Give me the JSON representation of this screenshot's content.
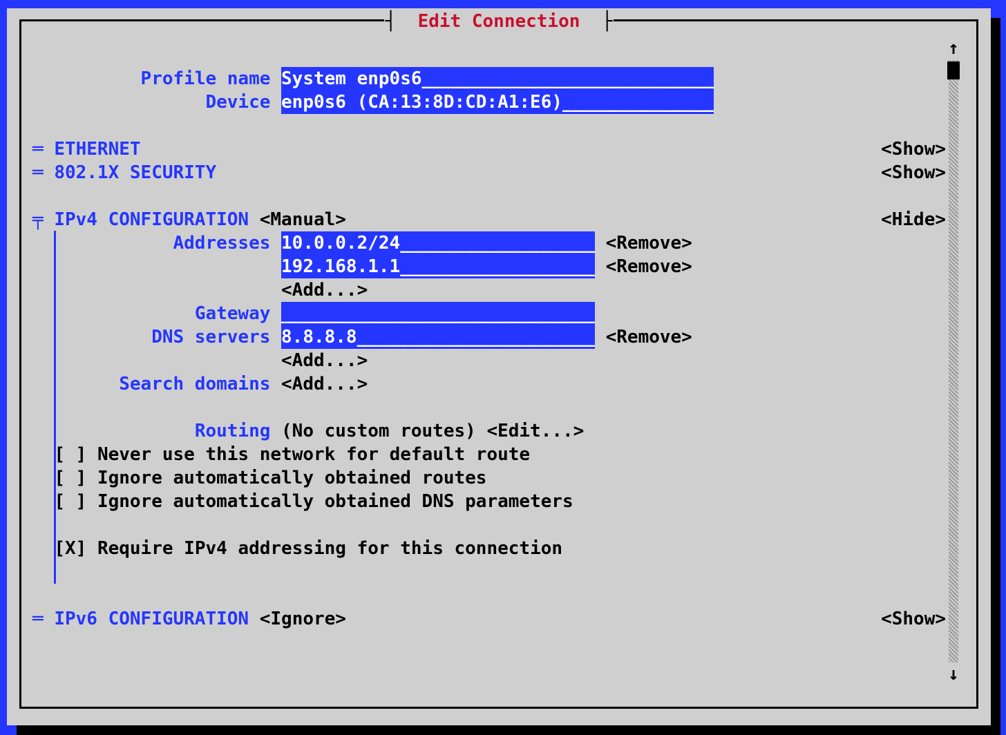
{
  "window": {
    "title": "Edit Connection"
  },
  "fields": {
    "profile_name_label": "Profile name",
    "profile_name_value": "System enp0s6",
    "device_label": "Device",
    "device_value": "enp0s6 (CA:13:8D:CD:A1:E6)"
  },
  "sections": {
    "ethernet": {
      "label": "ETHERNET",
      "toggle": "<Show>"
    },
    "dot1x": {
      "label": "802.1X SECURITY",
      "toggle": "<Show>"
    },
    "ipv4": {
      "label": "IPv4 CONFIGURATION",
      "mode": "<Manual>",
      "toggle": "<Hide>",
      "addresses_label": "Addresses",
      "addresses": [
        "10.0.0.2/24",
        "192.168.1.1"
      ],
      "gateway_label": "Gateway",
      "gateway_value": "",
      "dns_label": "DNS servers",
      "dns": [
        "8.8.8.8"
      ],
      "search_label": "Search domains",
      "routing_label": "Routing",
      "routing_text": "(No custom routes)",
      "routing_edit": "<Edit...>",
      "add_label": "<Add...>",
      "remove_label": "<Remove>",
      "opt_never_default": {
        "checked": false,
        "label": "Never use this network for default route"
      },
      "opt_ignore_routes": {
        "checked": false,
        "label": "Ignore automatically obtained routes"
      },
      "opt_ignore_dns": {
        "checked": false,
        "label": "Ignore automatically obtained DNS parameters"
      },
      "opt_require_ipv4": {
        "checked": true,
        "label": "Require IPv4 addressing for this connection"
      }
    },
    "ipv6": {
      "label": "IPv6 CONFIGURATION",
      "mode": "<Ignore>",
      "toggle": "<Show>"
    }
  }
}
